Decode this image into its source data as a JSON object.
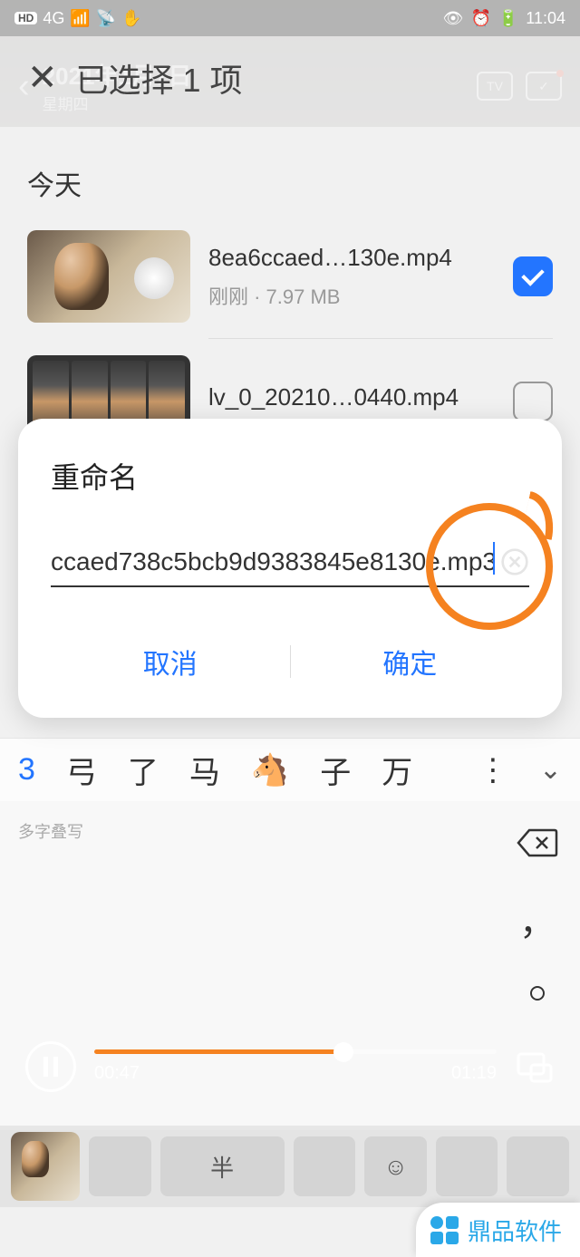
{
  "statusbar": {
    "hd": "HD",
    "net": "4G",
    "time": "11:04"
  },
  "bgheader": {
    "date": "2021年1月7日",
    "dow": "星期四",
    "tv": "TV"
  },
  "selheader": {
    "title": "已选择 1 项"
  },
  "section": {
    "title": "今天"
  },
  "files": [
    {
      "name": "8ea6ccaed…130e.mp4",
      "meta": "刚刚 · 7.97 MB",
      "checked": true
    },
    {
      "name": "lv_0_20210…0440.mp4",
      "meta": "",
      "checked": false
    }
  ],
  "dialog": {
    "title": "重命名",
    "value": "ccaed738c5bcb9d9383845e8130e.mp3",
    "cancel": "取消",
    "confirm": "确定"
  },
  "ime": {
    "candidates": [
      "3",
      "弓",
      "了",
      "马",
      "🐴",
      "子",
      "万"
    ],
    "more": "⋮",
    "hint": "多字叠写",
    "comma": "，"
  },
  "player": {
    "cur": "00:47",
    "dur": "01:19"
  },
  "keys": {
    "half": "半"
  },
  "brand": {
    "text": "鼎品软件"
  }
}
